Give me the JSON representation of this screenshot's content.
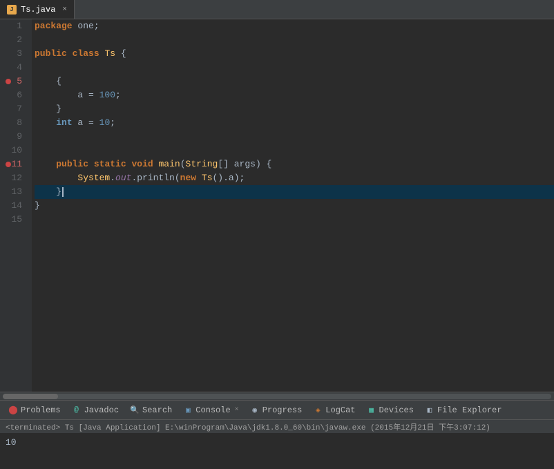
{
  "tab": {
    "icon_label": "J",
    "filename": "Ts.java",
    "close_label": "×"
  },
  "code": {
    "lines": [
      {
        "num": 1,
        "content": "package one;",
        "tokens": [
          {
            "type": "kw-package",
            "text": "package"
          },
          {
            "type": "plain",
            "text": " one;"
          }
        ]
      },
      {
        "num": 2,
        "content": "",
        "tokens": []
      },
      {
        "num": 3,
        "content": "public class Ts {",
        "tokens": [
          {
            "type": "kw-public",
            "text": "public"
          },
          {
            "type": "plain",
            "text": " "
          },
          {
            "type": "kw-class",
            "text": "class"
          },
          {
            "type": "plain",
            "text": " "
          },
          {
            "type": "class-name",
            "text": "Ts"
          },
          {
            "type": "plain",
            "text": " {"
          }
        ]
      },
      {
        "num": 4,
        "content": "",
        "tokens": []
      },
      {
        "num": 5,
        "content": "    {",
        "tokens": [
          {
            "type": "plain",
            "text": "    {"
          }
        ],
        "breakpoint": true
      },
      {
        "num": 6,
        "content": "        a = 100;",
        "tokens": [
          {
            "type": "plain",
            "text": "        a = "
          },
          {
            "type": "number",
            "text": "100"
          },
          {
            "type": "plain",
            "text": ";"
          }
        ]
      },
      {
        "num": 7,
        "content": "    }",
        "tokens": [
          {
            "type": "plain",
            "text": "    }"
          }
        ]
      },
      {
        "num": 8,
        "content": "    int a = 10;",
        "tokens": [
          {
            "type": "plain",
            "text": "    "
          },
          {
            "type": "kw-int",
            "text": "int"
          },
          {
            "type": "plain",
            "text": " a = "
          },
          {
            "type": "number",
            "text": "10"
          },
          {
            "type": "plain",
            "text": ";"
          }
        ]
      },
      {
        "num": 9,
        "content": "",
        "tokens": []
      },
      {
        "num": 10,
        "content": "",
        "tokens": []
      },
      {
        "num": 11,
        "content": "    public static void main(String[] args) {",
        "tokens": [
          {
            "type": "plain",
            "text": "    "
          },
          {
            "type": "kw-public",
            "text": "public"
          },
          {
            "type": "plain",
            "text": " "
          },
          {
            "type": "kw-static",
            "text": "static"
          },
          {
            "type": "plain",
            "text": " "
          },
          {
            "type": "kw-void",
            "text": "void"
          },
          {
            "type": "plain",
            "text": " "
          },
          {
            "type": "method-name",
            "text": "main"
          },
          {
            "type": "plain",
            "text": "("
          },
          {
            "type": "class-name",
            "text": "String"
          },
          {
            "type": "plain",
            "text": "[] args) {"
          }
        ],
        "breakpoint": true
      },
      {
        "num": 12,
        "content": "        System.out.println(new Ts().a);",
        "tokens": [
          {
            "type": "plain",
            "text": "        "
          },
          {
            "type": "class-name",
            "text": "System"
          },
          {
            "type": "plain",
            "text": "."
          },
          {
            "type": "italic-field",
            "text": "out"
          },
          {
            "type": "plain",
            "text": ".println("
          },
          {
            "type": "kw-new",
            "text": "new"
          },
          {
            "type": "plain",
            "text": " "
          },
          {
            "type": "class-name",
            "text": "Ts"
          },
          {
            "type": "plain",
            "text": "().a);"
          }
        ]
      },
      {
        "num": 13,
        "content": "    }",
        "tokens": [
          {
            "type": "plain",
            "text": "    }"
          },
          {
            "type": "cursor",
            "text": ""
          }
        ],
        "current": true
      },
      {
        "num": 14,
        "content": "}",
        "tokens": [
          {
            "type": "plain",
            "text": "}"
          }
        ]
      },
      {
        "num": 15,
        "content": "",
        "tokens": []
      }
    ]
  },
  "bottom_tabs": [
    {
      "id": "problems",
      "icon": "⬤",
      "icon_class": "icon-problems",
      "label": "Problems"
    },
    {
      "id": "javadoc",
      "icon": "@",
      "icon_class": "icon-javadoc",
      "label": "Javadoc"
    },
    {
      "id": "search",
      "icon": "🔍",
      "icon_class": "icon-search",
      "label": "Search"
    },
    {
      "id": "console",
      "icon": "▣",
      "icon_class": "icon-console",
      "label": "Console",
      "closeable": true
    },
    {
      "id": "progress",
      "icon": "◉",
      "icon_class": "icon-progress",
      "label": "Progress"
    },
    {
      "id": "logcat",
      "icon": "◈",
      "icon_class": "icon-logcat",
      "label": "LogCat"
    },
    {
      "id": "devices",
      "icon": "▦",
      "icon_class": "icon-devices",
      "label": "Devices"
    },
    {
      "id": "fileexplorer",
      "icon": "◧",
      "icon_class": "icon-fileexplorer",
      "label": "File Explorer"
    }
  ],
  "status_bar": {
    "text": "<terminated> Ts [Java Application] E:\\winProgram\\Java\\jdk1.8.0_60\\bin\\javaw.exe (2015年12月21日 下午3:07:12)"
  },
  "console_output": {
    "lines": [
      "10"
    ]
  }
}
